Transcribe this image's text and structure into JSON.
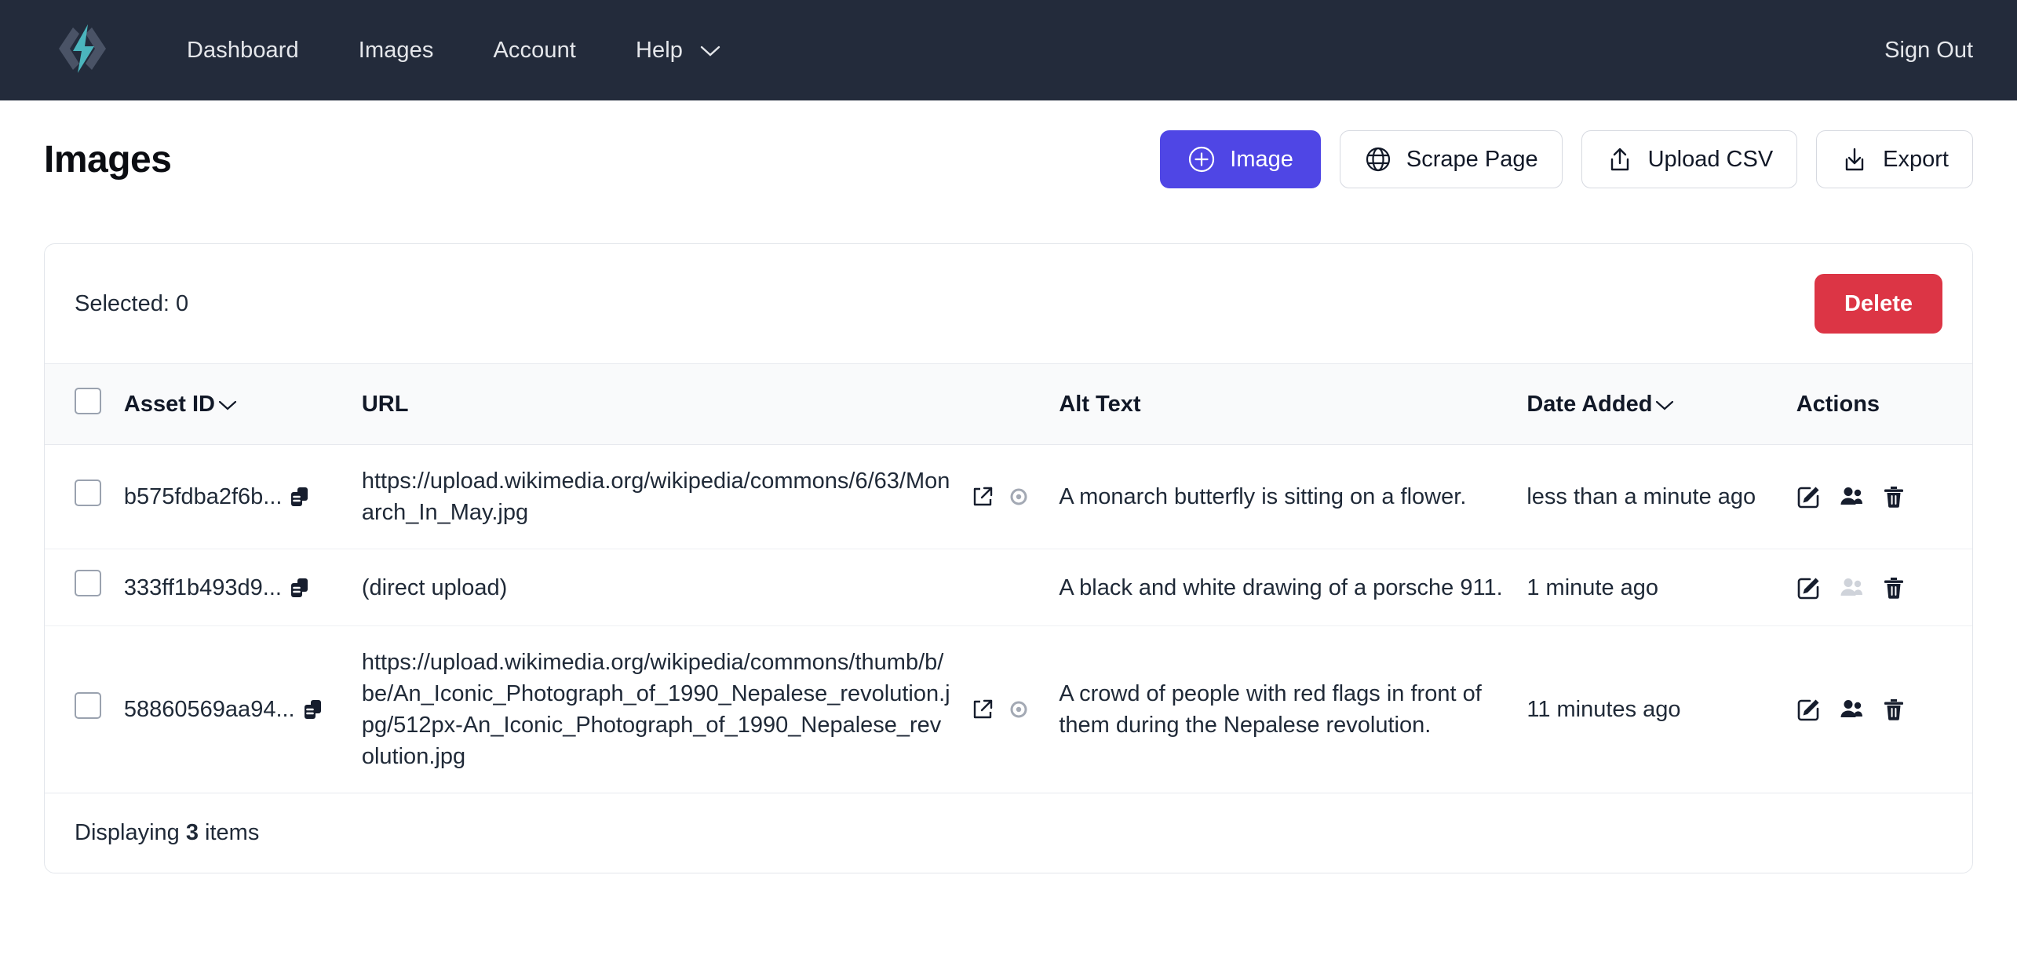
{
  "brand": {
    "logo_icon": "code-lightning-logo",
    "accent": "#4bb5bd"
  },
  "nav": {
    "links": [
      {
        "label": "Dashboard",
        "name": "nav-link-dashboard",
        "caret": false
      },
      {
        "label": "Images",
        "name": "nav-link-images",
        "caret": false
      },
      {
        "label": "Account",
        "name": "nav-link-account",
        "caret": false
      },
      {
        "label": "Help",
        "name": "nav-link-help",
        "caret": true
      }
    ],
    "sign_out": "Sign Out",
    "background": "#232b3b"
  },
  "header": {
    "title": "Images",
    "buttons": [
      {
        "label": "Image",
        "icon": "plus-circle-icon",
        "primary": true
      },
      {
        "label": "Scrape Page",
        "icon": "globe-icon",
        "primary": false
      },
      {
        "label": "Upload CSV",
        "icon": "upload-icon",
        "primary": false
      },
      {
        "label": "Export",
        "icon": "download-icon",
        "primary": false
      }
    ],
    "primary_color": "#4f46e5"
  },
  "toolbar": {
    "selected_label": "Selected: 0",
    "delete_label": "Delete",
    "delete_color": "#dc3545"
  },
  "table": {
    "columns": [
      {
        "label": "Asset ID",
        "sortable": true
      },
      {
        "label": "URL",
        "sortable": false
      },
      {
        "label": "Alt Text",
        "sortable": false
      },
      {
        "label": "Date Added",
        "sortable": true
      },
      {
        "label": "Actions",
        "sortable": false
      }
    ],
    "rows": [
      {
        "asset_id": "b575fdba2f6b...",
        "url": "https://upload.wikimedia.org/wikipedia/commons/6/63/Monarch_In_May.jpg",
        "has_url_icons": true,
        "alt_text": "A monarch butterfly is sitting on a flower.",
        "date_added": "less than a minute ago",
        "users_enabled": true
      },
      {
        "asset_id": "333ff1b493d9...",
        "url": "(direct upload)",
        "has_url_icons": false,
        "alt_text": "A black and white drawing of a porsche 911.",
        "date_added": "1 minute ago",
        "users_enabled": false
      },
      {
        "asset_id": "58860569aa94...",
        "url": "https://upload.wikimedia.org/wikipedia/commons/thumb/b/be/An_Iconic_Photograph_of_1990_Nepalese_revolution.jpg/512px-An_Iconic_Photograph_of_1990_Nepalese_revolution.jpg",
        "has_url_icons": true,
        "alt_text": "A crowd of people with red flags in front of them during the Nepalese revolution.",
        "date_added": "11 minutes ago",
        "users_enabled": true
      }
    ]
  },
  "footer": {
    "prefix": "Displaying ",
    "count": "3",
    "suffix": " items"
  }
}
